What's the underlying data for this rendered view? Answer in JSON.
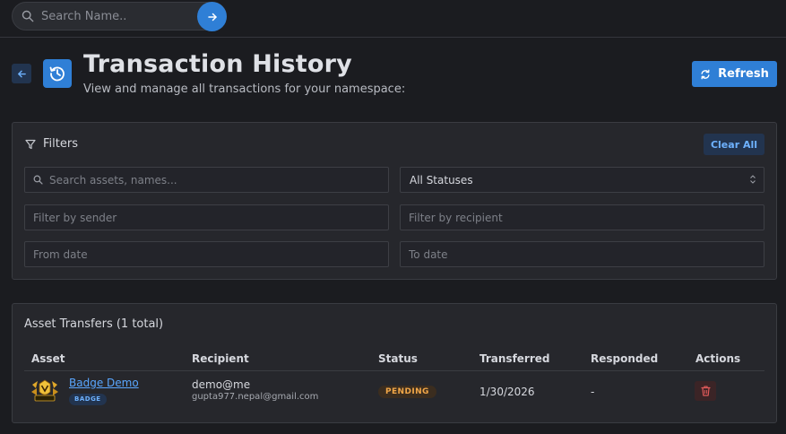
{
  "topbar": {
    "search_placeholder": "Search Name..",
    "search_icon": "search-icon",
    "go_icon": "arrow-right-icon"
  },
  "header": {
    "back_icon": "arrow-left-icon",
    "badge_icon": "history-icon",
    "title": "Transaction History",
    "subtitle": "View and manage all transactions for your namespace:",
    "refresh_label": "Refresh",
    "refresh_icon": "refresh-icon"
  },
  "filters": {
    "title": "Filters",
    "title_icon": "filter-icon",
    "clear_label": "Clear All",
    "search_placeholder": "Search assets, names...",
    "status_value": "All Statuses",
    "sender_placeholder": "Filter by sender",
    "recipient_placeholder": "Filter by recipient",
    "from_placeholder": "From date",
    "to_placeholder": "To date"
  },
  "transfers": {
    "title": "Asset Transfers (1 total)",
    "columns": [
      "Asset",
      "Recipient",
      "Status",
      "Transferred",
      "Responded",
      "Actions"
    ],
    "rows": [
      {
        "asset_name": "Badge Demo",
        "asset_type": "BADGE",
        "asset_icon": "badge-logo-icon",
        "recipient_name": "demo@me",
        "recipient_email": "gupta977.nepal@gmail.com",
        "status": "PENDING",
        "transferred": "1/30/2026",
        "responded": "-",
        "action_icon": "trash-icon"
      }
    ]
  },
  "colors": {
    "background": "#1b1c20",
    "card": "#26272c",
    "accent": "#2f7fd6",
    "link": "#5aa7ff",
    "pending": "#f2a748",
    "danger": "#e05a5a"
  }
}
